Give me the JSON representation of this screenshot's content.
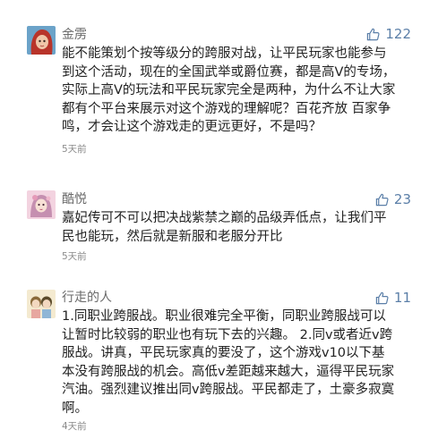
{
  "comments": [
    {
      "username": "金雳",
      "likes": "122",
      "text": "能不能策划个按等级分的跨服对战，让平民玩家也能参与\n到这个活动，现在的全国武举或爵位赛，都是高V的专场，\n实际上高V的玩法和平民玩家完全是两种，为什么不让大家\n都有个平台来展示对这个游戏的理解呢？百花齐放 百家争\n鸣，才会让这个游戏走的更远更好，不是吗？",
      "time": "5天前",
      "avatar_colors": {
        "bg": "#6ba3c9",
        "hair": "#b8342a",
        "face": "#f0c6a8"
      }
    },
    {
      "username": "酷悦",
      "likes": "23",
      "text": "嘉妃传可不可以把决战紫禁之巅的品级弄低点，让我们平\n民也能玩，然后就是新服和老服分开比",
      "time": "5天前",
      "avatar_colors": {
        "bg": "#f3d3e0",
        "hair": "#c58fb0",
        "face": "#f7e0d5"
      }
    },
    {
      "username": "行走的人",
      "likes": "11",
      "text": "1.同职业跨服战。职业很难完全平衡，同职业跨服战可以\n让暂时比较弱的职业也有玩下去的兴趣。 2.同v或者近v跨\n服战。讲真，平民玩家真的要没了，这个游戏v10以下基\n本没有跨服战的机会。高低v差距越来越大，逼得平民玩家\n汽油。强烈建议推出同v跨服战。平民都走了，土豪多寂寞\n啊。",
      "time": "4天前",
      "avatar_colors": {
        "bg": "#f4ead0",
        "hair": "#8a6a3a",
        "face": "#f3d8c0"
      }
    }
  ],
  "colors": {
    "like_accent": "#5b7fa8",
    "username": "#6a6a6a",
    "timestamp": "#8a8a8a"
  }
}
